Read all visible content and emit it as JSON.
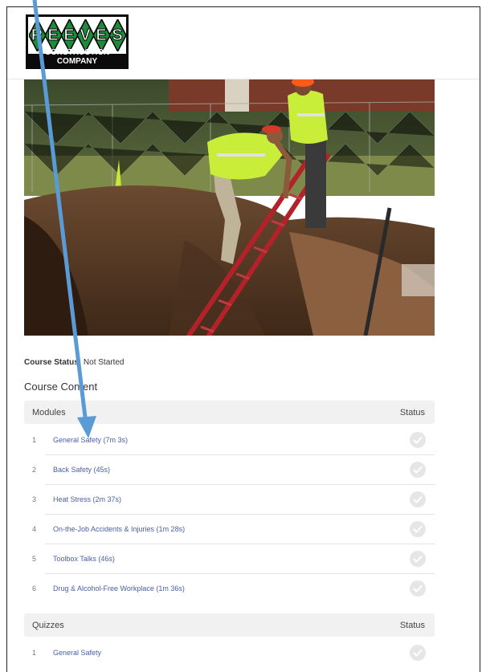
{
  "logo": {
    "letters": [
      "R",
      "E",
      "E",
      "V",
      "E",
      "S"
    ],
    "subtitle": "CONSTRUCTION COMPANY",
    "diamond_color": "#1e8a3c"
  },
  "course": {
    "status_label": "Course Status:",
    "status_value": "Not Started",
    "content_title": "Course Content"
  },
  "modules": {
    "header_label": "Modules",
    "status_header": "Status",
    "items": [
      {
        "num": "1",
        "title": "General Safety (7m 3s)"
      },
      {
        "num": "2",
        "title": "Back Safety (45s)"
      },
      {
        "num": "3",
        "title": "Heat Stress (2m 37s)"
      },
      {
        "num": "4",
        "title": "On-the-Job Accidents & Injuries (1m 28s)"
      },
      {
        "num": "5",
        "title": "Toolbox Talks (46s)"
      },
      {
        "num": "6",
        "title": "Drug & Alcohol-Free Workplace (1m 36s)"
      }
    ]
  },
  "quizzes": {
    "header_label": "Quizzes",
    "status_header": "Status",
    "items": [
      {
        "num": "1",
        "title": "General Safety"
      }
    ]
  },
  "colors": {
    "link": "#4a5fa8",
    "arrow": "#5b9bd5",
    "vest": "#c8ee3a"
  }
}
